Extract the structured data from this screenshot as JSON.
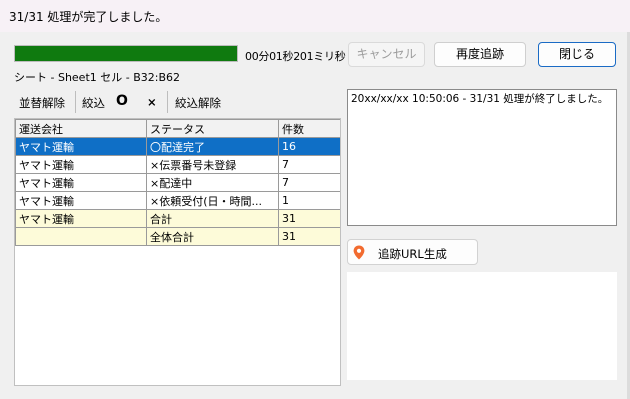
{
  "window": {
    "title": "31/31 処理が完了しました。"
  },
  "progress": {
    "fraction": 1.0,
    "fill_color": "#0f7a0f",
    "elapsed": "00分01秒201ミリ秒"
  },
  "buttons": {
    "cancel": "キャンセル",
    "retrace": "再度追跡",
    "close": "閉じる"
  },
  "sheet_info": "シート - Sheet1 セル - B32:B62",
  "toolbar": {
    "sort_clear": "並替解除",
    "filter": "絞込",
    "filter_circle": "O",
    "filter_cross": "×",
    "filter_clear": "絞込解除"
  },
  "table": {
    "headers": [
      "運送会社",
      "ステータス",
      "件数"
    ],
    "rows": [
      [
        "ヤマト運輸",
        "〇配達完了",
        "16"
      ],
      [
        "ヤマト運輸",
        "×伝票番号未登録",
        "7"
      ],
      [
        "ヤマト運輸",
        "×配達中",
        "7"
      ],
      [
        "ヤマト運輸",
        "×依頼受付(日・時間...",
        "1"
      ],
      [
        "ヤマト運輸",
        "合計",
        "31"
      ],
      [
        "",
        "全体合計",
        "31"
      ]
    ]
  },
  "log_text": "20xx/xx/xx 10:50:06 - 31/31 処理が終了しました。",
  "url_button": {
    "label": "追跡URL生成",
    "icon": "map-pin-icon",
    "icon_color": "#f26b2f"
  },
  "colors": {
    "selection": "#0f6fc6",
    "total_row": "#fdfbd9",
    "primary_border": "#1a6bc5"
  }
}
